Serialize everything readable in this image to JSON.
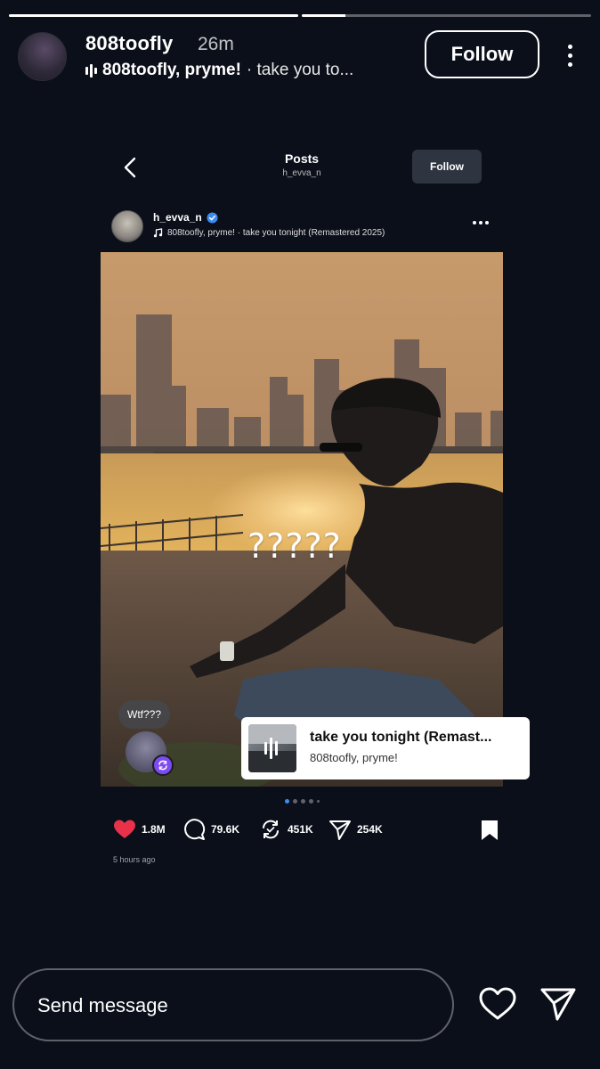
{
  "story": {
    "progress": [
      1.0,
      0.15
    ],
    "username": "808toofly",
    "time_ago": "26m",
    "music": {
      "artists": "808toofly, pryme!",
      "separator": " · ",
      "track": "take you to..."
    },
    "follow_label": "Follow"
  },
  "shared_post": {
    "nav": {
      "title": "Posts",
      "subtitle": "h_evva_n",
      "follow_label": "Follow"
    },
    "author": {
      "username": "h_evva_n",
      "verified": true,
      "music": "808toofly, pryme! · take you tonight (Remastered 2025)"
    },
    "image_overlay_text": "?????",
    "note": {
      "text": "Wtf???"
    },
    "carousel": {
      "count": 5,
      "active_index": 0
    },
    "actions": {
      "likes": "1.8M",
      "comments": "79.6K",
      "reposts": "451K",
      "shares": "254K",
      "liked": true
    },
    "posted_ago": "5 hours ago"
  },
  "music_sticker": {
    "title": "take you tonight (Remast...",
    "artists": "808toofly, pryme!"
  },
  "composer": {
    "placeholder": "Send message"
  },
  "colors": {
    "background": "#0b0f1a",
    "like_red": "#e8324a",
    "verified_blue": "#3c8cf0",
    "repost_purple": "#7d4cf0"
  }
}
